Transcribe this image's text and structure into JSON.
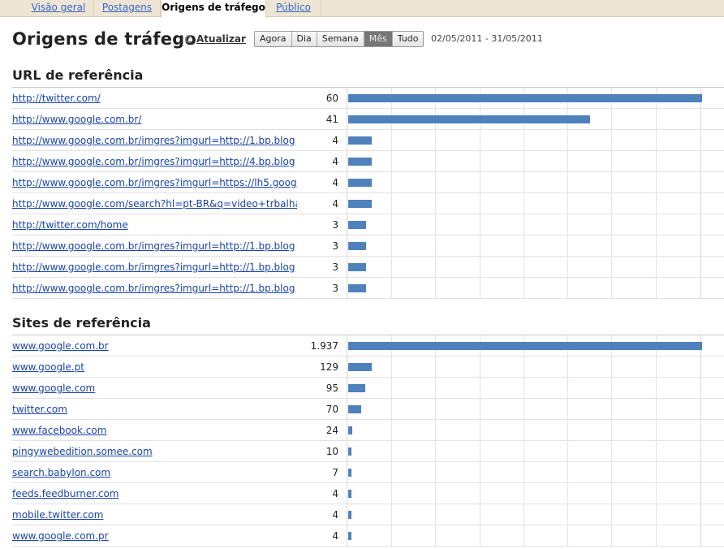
{
  "tabs": [
    {
      "label": "Visão geral",
      "active": false
    },
    {
      "label": "Postagens",
      "active": false
    },
    {
      "label": "Origens de tráfego",
      "active": true
    },
    {
      "label": "Público",
      "active": false
    }
  ],
  "header": {
    "title": "Origens de tráfego",
    "refresh_label": "Atualizar",
    "ranges": [
      "Agora",
      "Dia",
      "Semana",
      "Mês",
      "Tudo"
    ],
    "selected_range": "Mês",
    "date_range": "02/05/2011 - 31/05/2011"
  },
  "colors": {
    "bar": "#4f81bd"
  },
  "referring_urls": {
    "title": "URL de referência",
    "rows": [
      {
        "label": "http://twitter.com/",
        "count": "60",
        "value": 60
      },
      {
        "label": "http://www.google.com.br/",
        "count": "41",
        "value": 41
      },
      {
        "label": "http://www.google.com.br/imgres?imgurl=http://1.bp.blog",
        "count": "4",
        "value": 4
      },
      {
        "label": "http://www.google.com.br/imgres?imgurl=http://4.bp.blog",
        "count": "4",
        "value": 4
      },
      {
        "label": "http://www.google.com.br/imgres?imgurl=https://lh5.goog",
        "count": "4",
        "value": 4
      },
      {
        "label": "http://www.google.com/search?hl=pt-BR&q=video+trbalhan",
        "count": "4",
        "value": 4
      },
      {
        "label": "http://twitter.com/home",
        "count": "3",
        "value": 3
      },
      {
        "label": "http://www.google.com.br/imgres?imgurl=http://1.bp.blog",
        "count": "3",
        "value": 3
      },
      {
        "label": "http://www.google.com.br/imgres?imgurl=http://1.bp.blog",
        "count": "3",
        "value": 3
      },
      {
        "label": "http://www.google.com.br/imgres?imgurl=http://1.bp.blog",
        "count": "3",
        "value": 3
      }
    ]
  },
  "referring_sites": {
    "title": "Sites de referência",
    "rows": [
      {
        "label": "www.google.com.br",
        "count": "1.937",
        "value": 1937
      },
      {
        "label": "www.google.pt",
        "count": "129",
        "value": 129
      },
      {
        "label": "www.google.com",
        "count": "95",
        "value": 95
      },
      {
        "label": "twitter.com",
        "count": "70",
        "value": 70
      },
      {
        "label": "www.facebook.com",
        "count": "24",
        "value": 24
      },
      {
        "label": "pingywebedition.somee.com",
        "count": "10",
        "value": 10
      },
      {
        "label": "search.babylon.com",
        "count": "7",
        "value": 7
      },
      {
        "label": "feeds.feedburner.com",
        "count": "4",
        "value": 4
      },
      {
        "label": "mobile.twitter.com",
        "count": "4",
        "value": 4
      },
      {
        "label": "www.google.com.pr",
        "count": "4",
        "value": 4
      }
    ]
  }
}
